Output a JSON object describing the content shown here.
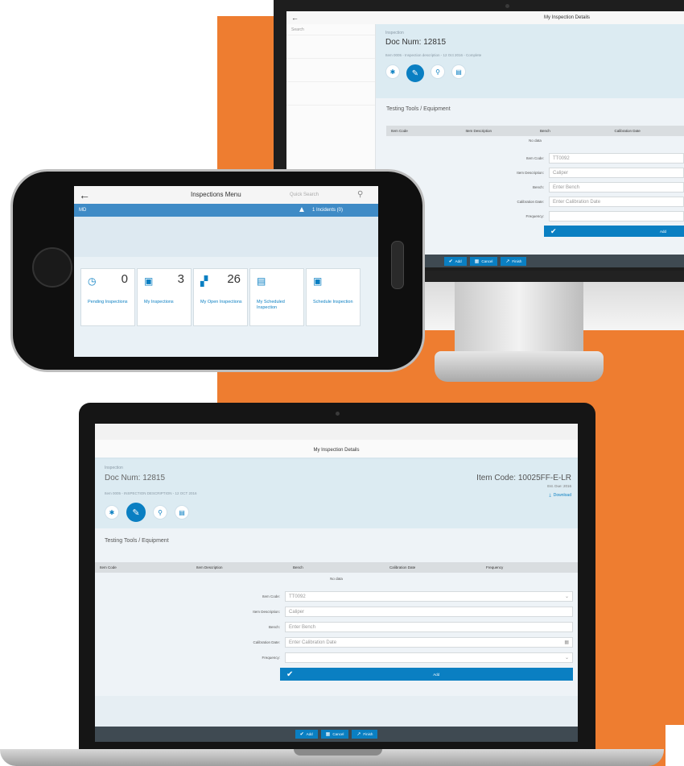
{
  "monitor": {
    "title": "My Inspection Details",
    "sidebar_search": "Search",
    "doc_label": "Inspection",
    "doc_num": "Doc Num: 12815",
    "subline": "Item 0005 - Inspection description - 12 Oct 2016 - Complete",
    "section_title": "Testing Tools / Equipment",
    "columns": [
      "Item Code",
      "Item Description",
      "Bench",
      "Calibration Date"
    ],
    "no_data": "No data",
    "fields": [
      {
        "label": "Item Code:",
        "value": "TT0092"
      },
      {
        "label": "Item Description:",
        "value": "Caliper"
      },
      {
        "label": "Bench:",
        "value": "Enter Bench"
      },
      {
        "label": "Calibration Date:",
        "value": "Enter Calibration Date"
      },
      {
        "label": "Frequency:",
        "value": ""
      }
    ],
    "add_label": "Add",
    "footer": [
      "Add",
      "Cancel",
      "Finish"
    ]
  },
  "phone": {
    "title": "Inspections Menu",
    "search_placeholder": "Quick Search",
    "header_left": "MD",
    "header_right": "1 Incidents (0)",
    "tiles": [
      {
        "icon": "clock-icon",
        "glyph": "◷",
        "count": "0",
        "label": "Pending Inspections"
      },
      {
        "icon": "clipboard-icon",
        "glyph": "▣",
        "count": "3",
        "label": "My Inspections"
      },
      {
        "icon": "chart-icon",
        "glyph": "▞",
        "count": "26",
        "label": "My Open Inspections"
      },
      {
        "icon": "document-icon",
        "glyph": "▤",
        "count": "",
        "label": "My Scheduled Inspection"
      },
      {
        "icon": "calendar-icon",
        "glyph": "▣",
        "count": "",
        "label": "Schedule Inspection"
      }
    ]
  },
  "laptop": {
    "title": "My Inspection Details",
    "doc_label": "Inspection",
    "doc_num": "Doc Num: 12815",
    "subline": "Item 0005 - INSPECTION DESCRIPTION - 12 OCT 2016",
    "item_code": "Item Code: 10025FF-E-LR",
    "item_sub": "Est. Due: 2016",
    "download_label": "Download",
    "section_title": "Testing Tools / Equipment",
    "columns": [
      "Item Code",
      "Item Description",
      "Bench",
      "Calibration Date",
      "Frequency"
    ],
    "no_data": "No data",
    "fields": [
      {
        "label": "Item Code:",
        "value": "TT0092"
      },
      {
        "label": "Item Description:",
        "value": "Caliper"
      },
      {
        "label": "Bench:",
        "value": "Enter Bench"
      },
      {
        "label": "Calibration Date:",
        "value": "Enter Calibration Date"
      },
      {
        "label": "Frequency:",
        "value": ""
      }
    ],
    "add_label": "Add",
    "footer": [
      "Add",
      "Cancel",
      "Finish"
    ]
  },
  "colors": {
    "accent": "#0a7fc2",
    "orange": "#ee7d30",
    "header_bg": "#dcebf2"
  }
}
